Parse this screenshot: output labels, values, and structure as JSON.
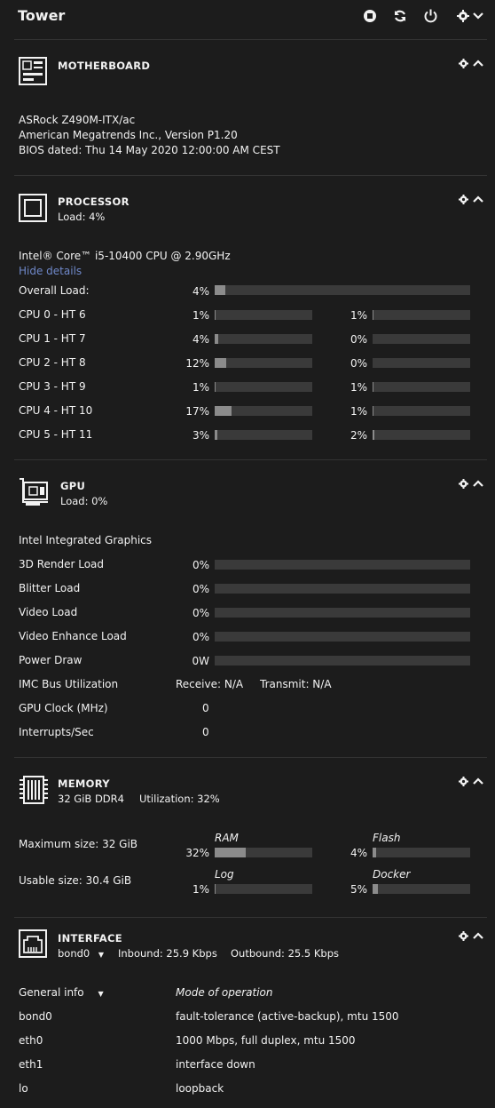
{
  "header": {
    "title": "Tower"
  },
  "motherboard": {
    "title": "MOTHERBOARD",
    "model": "ASRock Z490M-ITX/ac",
    "bios_vendor": "American Megatrends Inc., Version P1.20",
    "bios_date": "BIOS dated: Thu 14 May 2020 12:00:00 AM CEST"
  },
  "processor": {
    "title": "PROCESSOR",
    "load_summary": "Load: 4%",
    "cpu_name": "Intel® Core™ i5-10400 CPU @ 2.90GHz",
    "hide_details": "Hide details",
    "overall_label": "Overall Load:",
    "overall_pct": "4%",
    "overall_value": 0.04,
    "cores": [
      {
        "label": "CPU 0 - HT 6",
        "pct_a": "1%",
        "val_a": 0.01,
        "pct_b": "1%",
        "val_b": 0.01
      },
      {
        "label": "CPU 1 - HT 7",
        "pct_a": "4%",
        "val_a": 0.04,
        "pct_b": "0%",
        "val_b": 0
      },
      {
        "label": "CPU 2 - HT 8",
        "pct_a": "12%",
        "val_a": 0.12,
        "pct_b": "0%",
        "val_b": 0
      },
      {
        "label": "CPU 3 - HT 9",
        "pct_a": "1%",
        "val_a": 0.01,
        "pct_b": "1%",
        "val_b": 0.01
      },
      {
        "label": "CPU 4 - HT 10",
        "pct_a": "17%",
        "val_a": 0.17,
        "pct_b": "1%",
        "val_b": 0.01
      },
      {
        "label": "CPU 5 - HT 11",
        "pct_a": "3%",
        "val_a": 0.03,
        "pct_b": "2%",
        "val_b": 0.02
      }
    ]
  },
  "gpu": {
    "title": "GPU",
    "load_summary": "Load: 0%",
    "name": "Intel Integrated Graphics",
    "metrics": [
      {
        "label": "3D Render Load",
        "value_text": "0%",
        "value": 0
      },
      {
        "label": "Blitter Load",
        "value_text": "0%",
        "value": 0
      },
      {
        "label": "Video Load",
        "value_text": "0%",
        "value": 0
      },
      {
        "label": "Video Enhance Load",
        "value_text": "0%",
        "value": 0
      },
      {
        "label": "Power Draw",
        "value_text": "0W",
        "value": 0
      }
    ],
    "imc_label": "IMC Bus Utilization",
    "imc_receive": "Receive: N/A",
    "imc_transmit": "Transmit: N/A",
    "clock_label": "GPU Clock (MHz)",
    "clock_value": "0",
    "interrupts_label": "Interrupts/Sec",
    "interrupts_value": "0"
  },
  "memory": {
    "title": "MEMORY",
    "type": "32 GiB DDR4",
    "utilization": "Utilization: 32%",
    "max_size": "Maximum size: 32 GiB",
    "usable_size": "Usable size: 30.4 GiB",
    "pools": [
      {
        "name": "RAM",
        "pct": "32%",
        "value": 0.32
      },
      {
        "name": "Flash",
        "pct": "4%",
        "value": 0.04
      },
      {
        "name": "Log",
        "pct": "1%",
        "value": 0.01
      },
      {
        "name": "Docker",
        "pct": "5%",
        "value": 0.05
      }
    ]
  },
  "interface": {
    "title": "INTERFACE",
    "selected": "bond0",
    "inbound": "Inbound: 25.9 Kbps",
    "outbound": "Outbound: 25.5 Kbps",
    "info_select": "General info",
    "mode_header": "Mode of operation",
    "rows": [
      {
        "name": "bond0",
        "mode": "fault-tolerance (active-backup), mtu 1500"
      },
      {
        "name": "eth0",
        "mode": "1000 Mbps, full duplex, mtu 1500"
      },
      {
        "name": "eth1",
        "mode": "interface down"
      },
      {
        "name": "lo",
        "mode": "loopback"
      }
    ]
  },
  "colors": {
    "background": "#1c1c1c",
    "text": "#f2f2f2",
    "bar_track": "#3a3a3a",
    "bar_fill": "#8b8b8b",
    "link": "#6f88c9"
  }
}
